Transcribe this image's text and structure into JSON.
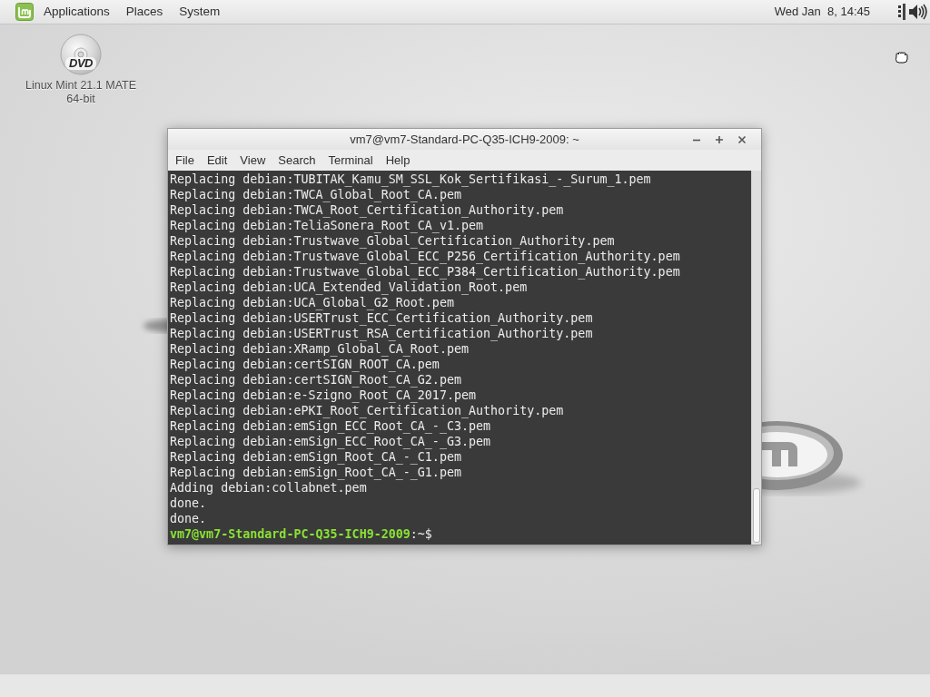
{
  "top_panel": {
    "menus": [
      "Applications",
      "Places",
      "System"
    ],
    "clock": "Wed Jan  8, 14:45"
  },
  "desktop_icons": [
    {
      "label": "Linux Mint 21.1 MATE 64-bit",
      "disc_label": "DVD"
    }
  ],
  "terminal": {
    "title": "vm7@vm7-Standard-PC-Q35-ICH9-2009: ~",
    "menu": [
      "File",
      "Edit",
      "View",
      "Search",
      "Terminal",
      "Help"
    ],
    "lines": [
      {
        "kind": "output",
        "text": "Replacing debian:TUBITAK_Kamu_SM_SSL_Kok_Sertifikasi_-_Surum_1.pem"
      },
      {
        "kind": "output",
        "text": "Replacing debian:TWCA_Global_Root_CA.pem"
      },
      {
        "kind": "output",
        "text": "Replacing debian:TWCA_Root_Certification_Authority.pem"
      },
      {
        "kind": "output",
        "text": "Replacing debian:TeliaSonera_Root_CA_v1.pem"
      },
      {
        "kind": "output",
        "text": "Replacing debian:Trustwave_Global_Certification_Authority.pem"
      },
      {
        "kind": "output",
        "text": "Replacing debian:Trustwave_Global_ECC_P256_Certification_Authority.pem"
      },
      {
        "kind": "output",
        "text": "Replacing debian:Trustwave_Global_ECC_P384_Certification_Authority.pem"
      },
      {
        "kind": "output",
        "text": "Replacing debian:UCA_Extended_Validation_Root.pem"
      },
      {
        "kind": "output",
        "text": "Replacing debian:UCA_Global_G2_Root.pem"
      },
      {
        "kind": "output",
        "text": "Replacing debian:USERTrust_ECC_Certification_Authority.pem"
      },
      {
        "kind": "output",
        "text": "Replacing debian:USERTrust_RSA_Certification_Authority.pem"
      },
      {
        "kind": "output",
        "text": "Replacing debian:XRamp_Global_CA_Root.pem"
      },
      {
        "kind": "output",
        "text": "Replacing debian:certSIGN_ROOT_CA.pem"
      },
      {
        "kind": "output",
        "text": "Replacing debian:certSIGN_Root_CA_G2.pem"
      },
      {
        "kind": "output",
        "text": "Replacing debian:e-Szigno_Root_CA_2017.pem"
      },
      {
        "kind": "output",
        "text": "Replacing debian:ePKI_Root_Certification_Authority.pem"
      },
      {
        "kind": "output",
        "text": "Replacing debian:emSign_ECC_Root_CA_-_C3.pem"
      },
      {
        "kind": "output",
        "text": "Replacing debian:emSign_ECC_Root_CA_-_G3.pem"
      },
      {
        "kind": "output",
        "text": "Replacing debian:emSign_Root_CA_-_C1.pem"
      },
      {
        "kind": "output",
        "text": "Replacing debian:emSign_Root_CA_-_G1.pem"
      },
      {
        "kind": "output",
        "text": "Adding debian:collabnet.pem"
      },
      {
        "kind": "output",
        "text": "done."
      },
      {
        "kind": "output",
        "text": "done."
      },
      {
        "kind": "prompt",
        "text": "**vm7@vm7-Standard-PC-Q35-ICH9-2009**:~$"
      }
    ]
  }
}
